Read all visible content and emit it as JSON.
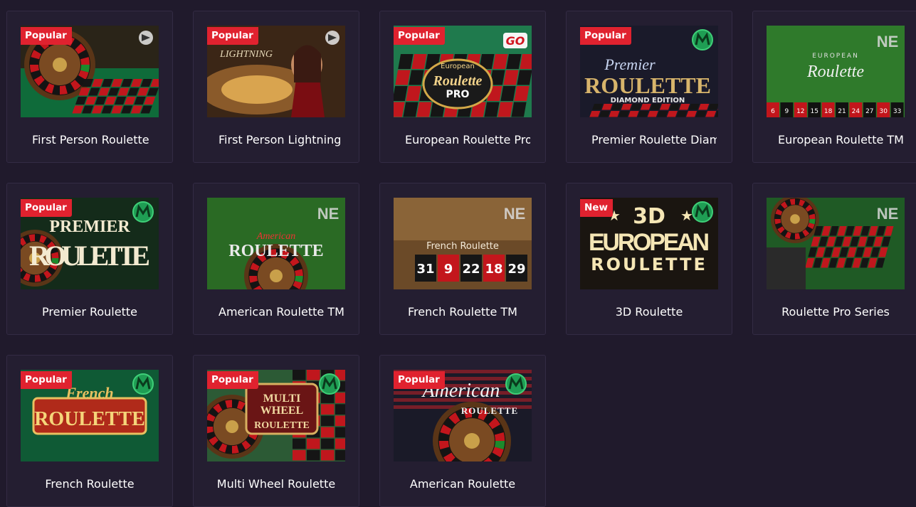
{
  "games": [
    {
      "title": "First Person Roulette",
      "badge": "Popular",
      "provider": "evolution",
      "art": "fp-roulette"
    },
    {
      "title": "First Person Lightning Roulette",
      "badge": "Popular",
      "provider": "evolution",
      "art": "lightning"
    },
    {
      "title": "European Roulette Pro",
      "badge": "Popular",
      "provider": "netent-go",
      "art": "euro-pro",
      "provider_text": "GO"
    },
    {
      "title": "Premier Roulette Diamond Edition",
      "badge": "Popular",
      "provider": "microgaming",
      "art": "premier-diamond",
      "art_text": [
        "Premier",
        "ROULETTE",
        "DIAMOND EDITION"
      ]
    },
    {
      "title": "European Roulette TM",
      "badge": "",
      "provider": "netent",
      "art": "euro-tm",
      "provider_text": "NE",
      "art_text": [
        "EUROPEAN",
        "Roulette"
      ],
      "numbers": [
        "6",
        "9",
        "12",
        "15",
        "18",
        "21",
        "24",
        "27",
        "30",
        "33"
      ]
    },
    {
      "title": "Premier Roulette",
      "badge": "Popular",
      "provider": "microgaming",
      "art": "premier",
      "art_text": [
        "PREMIER",
        "ROULETTE"
      ]
    },
    {
      "title": "American Roulette TM",
      "badge": "",
      "provider": "netent",
      "art": "american-tm",
      "provider_text": "NE",
      "art_text": [
        "American",
        "ROULETTE"
      ]
    },
    {
      "title": "French Roulette TM",
      "badge": "",
      "provider": "netent",
      "art": "french-tm",
      "provider_text": "NE",
      "art_text": [
        "French Roulette"
      ],
      "numbers": [
        "31",
        "9",
        "22",
        "18",
        "29"
      ]
    },
    {
      "title": "3D Roulette",
      "badge": "New",
      "provider": "microgaming",
      "art": "3d",
      "art_text": [
        "3D",
        "EUROPEAN",
        "ROULETTE"
      ]
    },
    {
      "title": "Roulette Pro Series",
      "badge": "",
      "provider": "netent",
      "art": "pro-series",
      "provider_text": "NE"
    },
    {
      "title": "French Roulette",
      "badge": "Popular",
      "provider": "microgaming",
      "art": "french",
      "art_text": [
        "French",
        "ROULETTE"
      ]
    },
    {
      "title": "Multi Wheel Roulette",
      "badge": "Popular",
      "provider": "microgaming",
      "art": "multi-wheel",
      "art_text": [
        "MULTI",
        "WHEEL",
        "ROULETTE"
      ]
    },
    {
      "title": "American Roulette",
      "badge": "Popular",
      "provider": "microgaming",
      "art": "american",
      "art_text": [
        "American",
        "ROULETTE"
      ]
    }
  ]
}
